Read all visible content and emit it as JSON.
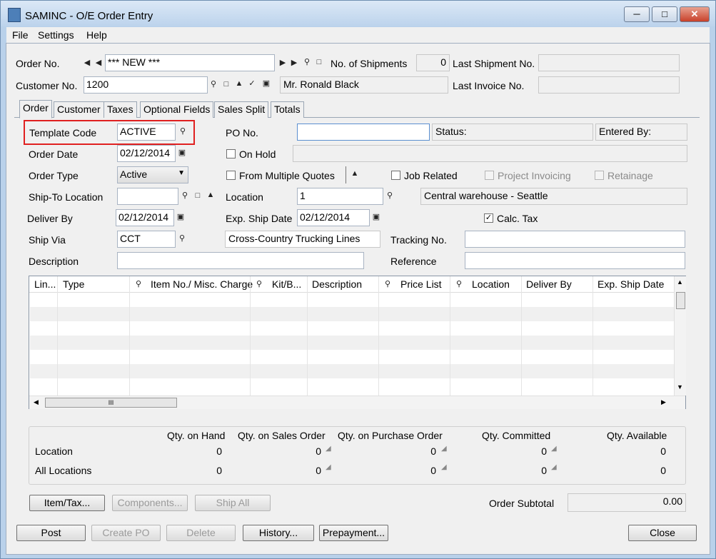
{
  "window": {
    "title": "SAMINC - O/E Order Entry",
    "app_icon": "app-icon"
  },
  "menu": [
    "File",
    "Settings",
    "Help"
  ],
  "header": {
    "order_no_label": "Order No.",
    "order_no_value": "*** NEW ***",
    "shipments_label": "No. of Shipments",
    "shipments_value": "0",
    "last_shipment_label": "Last Shipment No.",
    "last_shipment_value": "",
    "customer_no_label": "Customer No.",
    "customer_no_value": "1200",
    "customer_name": "Mr. Ronald Black",
    "last_invoice_label": "Last Invoice No.",
    "last_invoice_value": ""
  },
  "tabs": [
    "Order",
    "Customer",
    "Taxes",
    "Optional Fields",
    "Sales Split",
    "Totals"
  ],
  "order": {
    "template_code_label": "Template Code",
    "template_code_value": "ACTIVE",
    "po_no_label": "PO No.",
    "po_no_value": "",
    "status_label": "Status:",
    "entered_by_label": "Entered By:",
    "order_date_label": "Order Date",
    "order_date_value": "02/12/2014",
    "on_hold_label": "On Hold",
    "on_hold_checked": false,
    "order_type_label": "Order Type",
    "order_type_value": "Active",
    "from_quotes_label": "From Multiple Quotes",
    "job_related_label": "Job Related",
    "project_invoicing_label": "Project Invoicing",
    "retainage_label": "Retainage",
    "ship_to_label": "Ship-To Location",
    "ship_to_value": "",
    "location_label": "Location",
    "location_value": "1",
    "location_desc": "Central warehouse - Seattle",
    "deliver_by_label": "Deliver By",
    "deliver_by_value": "02/12/2014",
    "exp_ship_label": "Exp. Ship Date",
    "exp_ship_value": "02/12/2014",
    "calc_tax_label": "Calc. Tax",
    "calc_tax_checked": true,
    "ship_via_label": "Ship Via",
    "ship_via_value": "CCT",
    "ship_via_desc": "Cross-Country Trucking Lines",
    "tracking_label": "Tracking No.",
    "tracking_value": "",
    "description_label": "Description",
    "description_value": "",
    "reference_label": "Reference",
    "reference_value": ""
  },
  "grid": {
    "columns": [
      "Lin...",
      "Type",
      "Item No./ Misc. Charge",
      "Kit/B...",
      "Description",
      "Price List",
      "Location",
      "Deliver By",
      "Exp. Ship Date"
    ],
    "hscroll_grip": "III"
  },
  "quantities": {
    "headers": [
      "Qty. on Hand",
      "Qty. on Sales Order",
      "Qty. on Purchase Order",
      "Qty. Committed",
      "Qty. Available"
    ],
    "rows": [
      {
        "label": "Location",
        "values": [
          "0",
          "0",
          "0",
          "0",
          "0"
        ]
      },
      {
        "label": "All Locations",
        "values": [
          "0",
          "0",
          "0",
          "0",
          "0"
        ]
      }
    ]
  },
  "bottom": {
    "item_tax": "Item/Tax...",
    "components": "Components...",
    "ship_all": "Ship All",
    "order_subtotal_label": "Order Subtotal",
    "order_subtotal_value": "0.00"
  },
  "footer": {
    "post": "Post",
    "create_po": "Create PO",
    "delete": "Delete",
    "history": "History...",
    "prepayment": "Prepayment...",
    "close": "Close"
  },
  "colors": {
    "highlight_box": "#e02020",
    "title_bar": "#bcd3ec",
    "client_bg": "#f0f0f0"
  }
}
